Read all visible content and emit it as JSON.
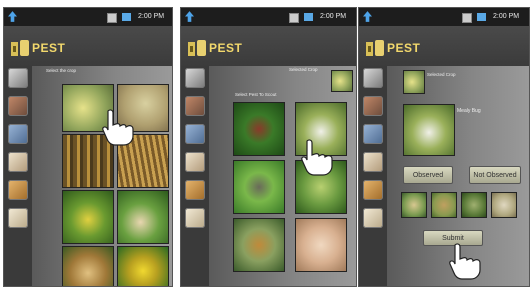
{
  "status_bar": {
    "time": "2:00 PM"
  },
  "app": {
    "name": "PEST"
  },
  "screen1": {
    "caption": "Select the crop"
  },
  "screen2": {
    "selected_caption": "Selected Crop",
    "caption": "Select Pest To Scout"
  },
  "screen3": {
    "selected_caption": "Selected Crop",
    "pest_name": "Mealy Bug",
    "observed_label": "Observed",
    "not_observed_label": "Not Observed",
    "submit_label": "Submit"
  },
  "colors": {
    "accent": "#f2d86c",
    "statusbar": "#1d1d1d",
    "button": "#c8c8b0"
  }
}
